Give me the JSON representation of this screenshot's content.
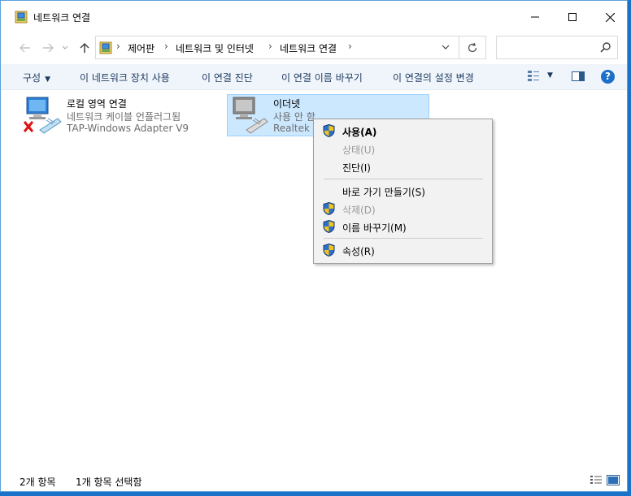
{
  "window": {
    "title": "네트워크 연결"
  },
  "address": {
    "crumbs": [
      "제어판",
      "네트워크 및 인터넷",
      "네트워크 연결"
    ],
    "search_placeholder": ""
  },
  "toolbar": {
    "organize": "구성",
    "disable_device": "이 네트워크 장치 사용",
    "diagnose": "이 연결 진단",
    "rename": "이 연결 이름 바꾸기",
    "change_settings": "이 연결의 설정 변경"
  },
  "connections": [
    {
      "name": "로컬 영역 연결",
      "status": "네트워크 케이블 언플러그됨",
      "adapter": "TAP-Windows Adapter V9",
      "selected": false,
      "error": true
    },
    {
      "name": "이더넷",
      "status": "사용 안 함",
      "adapter": "Realtek P",
      "selected": true,
      "error": false
    }
  ],
  "context_menu": {
    "items": [
      {
        "label": "사용(A)",
        "shield": true,
        "enabled": true,
        "bold": true
      },
      {
        "label": "상태(U)",
        "shield": false,
        "enabled": false,
        "bold": false
      },
      {
        "label": "진단(I)",
        "shield": false,
        "enabled": true,
        "bold": false
      },
      {
        "label": "바로 가기 만들기(S)",
        "shield": false,
        "enabled": true,
        "bold": false
      },
      {
        "label": "삭제(D)",
        "shield": true,
        "enabled": false,
        "bold": false
      },
      {
        "label": "이름 바꾸기(M)",
        "shield": true,
        "enabled": true,
        "bold": false
      },
      {
        "label": "속성(R)",
        "shield": true,
        "enabled": true,
        "bold": false
      }
    ]
  },
  "status": {
    "count": "2개 항목",
    "selected": "1개 항목 선택함"
  },
  "colors": {
    "accent": "#1c6fc9",
    "selection": "#cce8ff",
    "desktop": "#1a73c9"
  }
}
